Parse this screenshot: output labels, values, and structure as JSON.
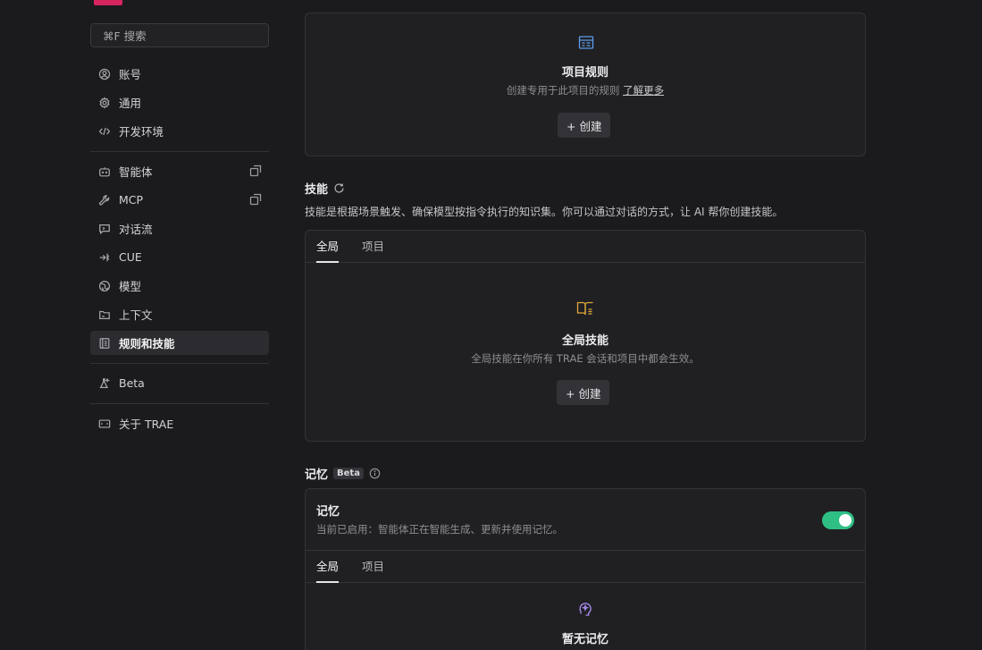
{
  "search": {
    "placeholder": "⌘F 搜索"
  },
  "sidebar": {
    "items": [
      {
        "label": "账号",
        "icon": "user-circle-icon"
      },
      {
        "label": "通用",
        "icon": "gear-icon"
      },
      {
        "label": "开发环境",
        "icon": "code-icon"
      },
      {
        "label": "智能体",
        "icon": "robot-icon",
        "external": true
      },
      {
        "label": "MCP",
        "icon": "wrench-icon",
        "external": true
      },
      {
        "label": "对话流",
        "icon": "chat-flow-icon"
      },
      {
        "label": "CUE",
        "icon": "cue-icon"
      },
      {
        "label": "模型",
        "icon": "globe-icon"
      },
      {
        "label": "上下文",
        "icon": "context-icon"
      },
      {
        "label": "规则和技能",
        "icon": "rules-icon",
        "active": true
      },
      {
        "label": "Beta",
        "icon": "flask-icon"
      },
      {
        "label": "关于 TRAE",
        "icon": "trae-icon"
      }
    ]
  },
  "project_rules": {
    "title": "项目规则",
    "desc": "创建专用于此项目的规则",
    "learn_more": "了解更多",
    "create": "+ 创建"
  },
  "skills": {
    "title": "技能",
    "desc": "技能是根据场景触发、确保模型按指令执行的知识集。你可以通过对话的方式，让 AI 帮你创建技能。",
    "tabs": [
      "全局",
      "项目"
    ],
    "empty_title": "全局技能",
    "empty_desc": "全局技能在你所有 TRAE 会话和项目中都会生效。",
    "create": "+ 创建"
  },
  "memory": {
    "title": "记忆",
    "badge": "Beta",
    "card_title": "记忆",
    "card_desc": "当前已启用：智能体正在智能生成、更新并使用记忆。",
    "enabled": true,
    "tabs": [
      "全局",
      "项目"
    ],
    "empty_title": "暂无记忆"
  },
  "colors": {
    "accent": "#2fbf85",
    "brand": "#d6245f"
  }
}
